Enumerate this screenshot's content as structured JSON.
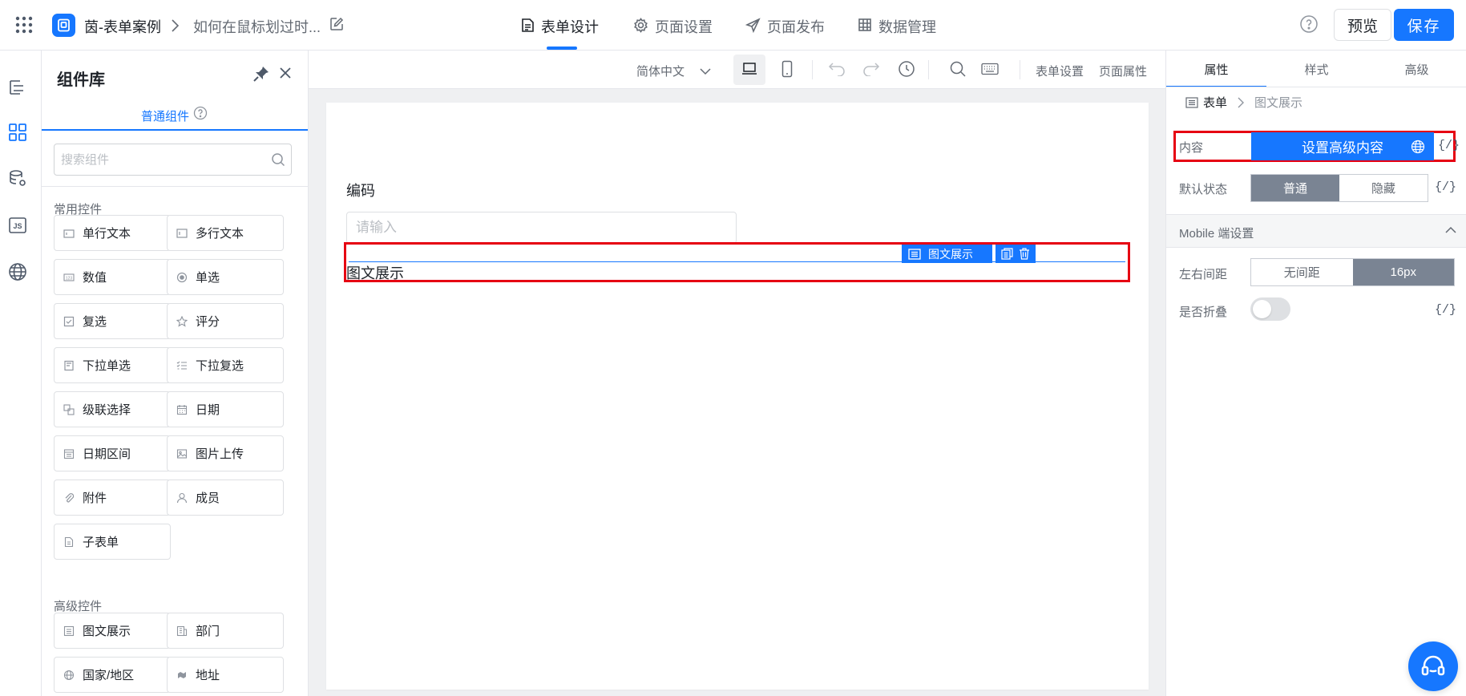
{
  "topbar": {
    "app_name": "茵-表单案例",
    "page_name": "如何在鼠标划过时...",
    "tabs": [
      {
        "label": "表单设计",
        "icon": "document-icon",
        "active": true
      },
      {
        "label": "页面设置",
        "icon": "gear-icon",
        "active": false
      },
      {
        "label": "页面发布",
        "icon": "send-icon",
        "active": false
      },
      {
        "label": "数据管理",
        "icon": "table-icon",
        "active": false
      }
    ],
    "preview_label": "预览",
    "save_label": "保存"
  },
  "library": {
    "title": "组件库",
    "tab_label": "普通组件",
    "search_placeholder": "搜索组件",
    "common_title": "常用控件",
    "common_items": [
      {
        "label": "单行文本",
        "icon": "single-line-icon"
      },
      {
        "label": "多行文本",
        "icon": "multi-line-icon"
      },
      {
        "label": "数值",
        "icon": "number-icon"
      },
      {
        "label": "单选",
        "icon": "radio-icon"
      },
      {
        "label": "复选",
        "icon": "checkbox-icon"
      },
      {
        "label": "评分",
        "icon": "star-icon"
      },
      {
        "label": "下拉单选",
        "icon": "dropdown-icon"
      },
      {
        "label": "下拉复选",
        "icon": "multi-select-icon"
      },
      {
        "label": "级联选择",
        "icon": "cascade-icon"
      },
      {
        "label": "日期",
        "icon": "calendar-icon"
      },
      {
        "label": "日期区间",
        "icon": "date-range-icon"
      },
      {
        "label": "图片上传",
        "icon": "image-icon"
      },
      {
        "label": "附件",
        "icon": "attachment-icon"
      },
      {
        "label": "成员",
        "icon": "user-icon"
      },
      {
        "label": "子表单",
        "icon": "subform-icon"
      }
    ],
    "advanced_title": "高级控件",
    "advanced_items": [
      {
        "label": "图文展示",
        "icon": "rich-text-icon"
      },
      {
        "label": "部门",
        "icon": "department-icon"
      },
      {
        "label": "国家/地区",
        "icon": "globe-icon"
      },
      {
        "label": "地址",
        "icon": "map-icon"
      }
    ]
  },
  "canvas_toolbar": {
    "language": "简体中文",
    "form_settings": "表单设置",
    "page_props": "页面属性"
  },
  "form": {
    "field_label": "编码",
    "field_placeholder": "请输入",
    "selected_badge": "图文展示",
    "selected_text": "图文展示"
  },
  "props": {
    "tabs": [
      "属性",
      "样式",
      "高级"
    ],
    "crumb_parent": "表单",
    "crumb_current": "图文展示",
    "content_label": "内容",
    "content_button": "设置高级内容",
    "code_symbol": "{/}",
    "default_state_label": "默认状态",
    "state_options": [
      "普通",
      "隐藏"
    ],
    "mobile_section": "Mobile 端设置",
    "padding_label": "左右间距",
    "padding_options": [
      "无间距",
      "16px"
    ],
    "collapse_label": "是否折叠"
  },
  "colors": {
    "accent": "#1677ff",
    "highlight": "#e60012",
    "segment_active": "#7a8493"
  }
}
